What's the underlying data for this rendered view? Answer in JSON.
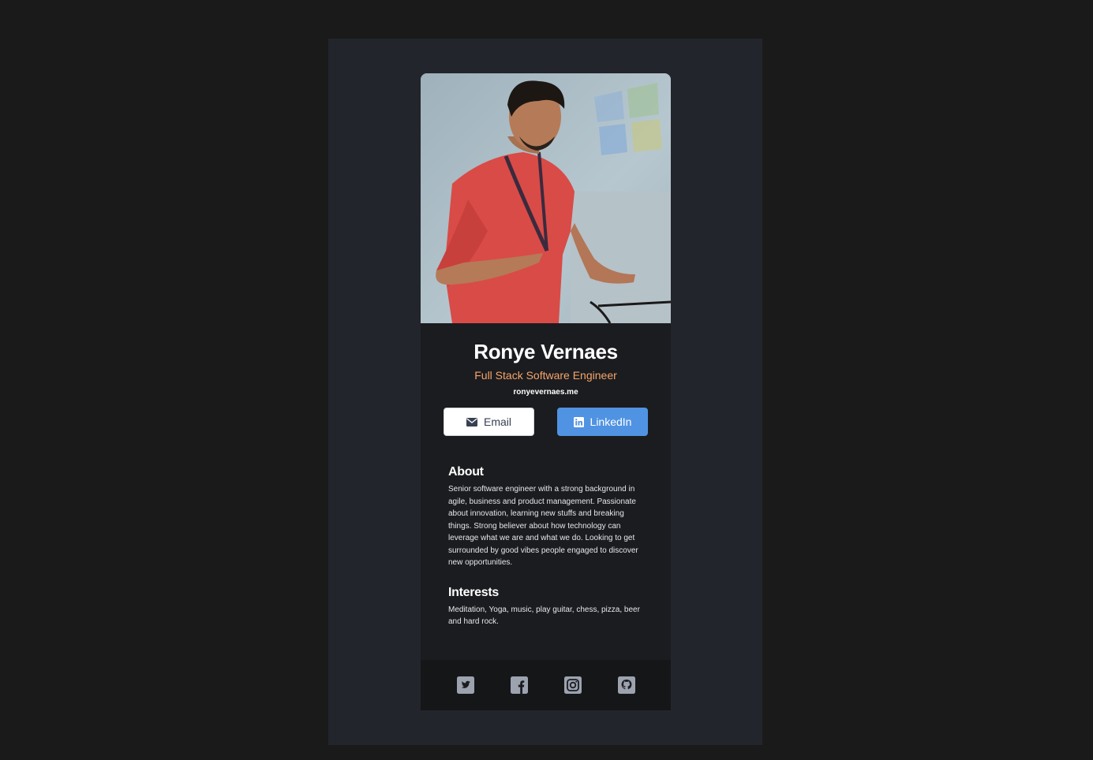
{
  "profile": {
    "name": "Ronye Vernaes",
    "title": "Full Stack Software Engineer",
    "website": "ronyevernaes.me"
  },
  "buttons": {
    "email_label": "Email",
    "email_icon": "envelope-icon",
    "linkedin_label": "LinkedIn",
    "linkedin_icon": "linkedin-icon"
  },
  "about": {
    "heading": "About",
    "text": "Senior software engineer with a strong background in agile, business and product management. Passionate about innovation, learning new stuffs and breaking things. Strong believer about how technology can leverage what we are and what we do. Looking to get surrounded by good vibes people engaged to discover new opportunities."
  },
  "interests": {
    "heading": "Interests",
    "text": "Meditation, Yoga, music, play guitar, chess, pizza, beer and hard rock."
  },
  "footer": {
    "social_icons": [
      "twitter-icon",
      "facebook-icon",
      "instagram-icon",
      "github-icon"
    ]
  },
  "colors": {
    "page_bg": "#1a1a1a",
    "frame_bg": "#23252c",
    "card_bg": "#1b1c1f",
    "footer_bg": "#151618",
    "accent_title": "#f5a56b",
    "linkedin_blue": "#5093e2",
    "social_icon": "#9ca3af"
  }
}
